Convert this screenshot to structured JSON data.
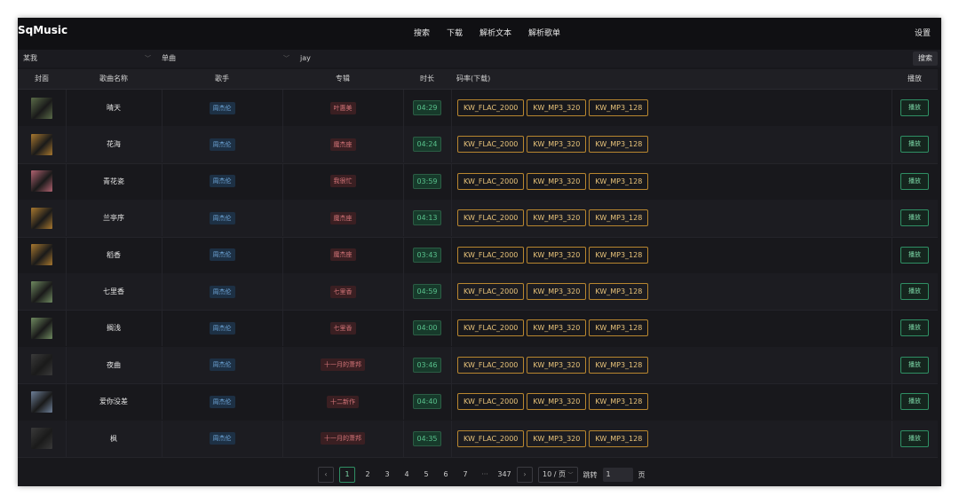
{
  "app": {
    "title": "SqMusic"
  },
  "nav": {
    "items": [
      "搜索",
      "下载",
      "解析文本",
      "解析歌单"
    ],
    "settings": "设置"
  },
  "search": {
    "source": "某我",
    "type": "单曲",
    "keyword": "jay",
    "button": "搜索"
  },
  "table": {
    "headers": [
      "封面",
      "歌曲名称",
      "歌手",
      "专辑",
      "时长",
      "码率(下载)",
      "播放"
    ],
    "rows": [
      {
        "name": "晴天",
        "singer": "周杰伦",
        "album": "叶惠美",
        "duration": "04:29",
        "cover_color": "#5a6b48"
      },
      {
        "name": "花海",
        "singer": "周杰伦",
        "album": "魔杰座",
        "duration": "04:24",
        "cover_color": "#a8782f"
      },
      {
        "name": "青花瓷",
        "singer": "周杰伦",
        "album": "我很忙",
        "duration": "03:59",
        "cover_color": "#b06270"
      },
      {
        "name": "兰亭序",
        "singer": "周杰伦",
        "album": "魔杰座",
        "duration": "04:13",
        "cover_color": "#a8782f"
      },
      {
        "name": "稻香",
        "singer": "周杰伦",
        "album": "魔杰座",
        "duration": "03:43",
        "cover_color": "#a8782f"
      },
      {
        "name": "七里香",
        "singer": "周杰伦",
        "album": "七里香",
        "duration": "04:59",
        "cover_color": "#6f8a60"
      },
      {
        "name": "搁浅",
        "singer": "周杰伦",
        "album": "七里香",
        "duration": "04:00",
        "cover_color": "#6f8a60"
      },
      {
        "name": "夜曲",
        "singer": "周杰伦",
        "album": "十一月的萧邦",
        "duration": "03:46",
        "cover_color": "#3a3a3a"
      },
      {
        "name": "爱你没差",
        "singer": "周杰伦",
        "album": "十二新作",
        "duration": "04:40",
        "cover_color": "#6d7f98"
      },
      {
        "name": "枫",
        "singer": "周杰伦",
        "album": "十一月的萧邦",
        "duration": "04:35",
        "cover_color": "#3a3a3a"
      }
    ],
    "qualities": [
      "KW_FLAC_2000",
      "KW_MP3_320",
      "KW_MP3_128"
    ],
    "play_label": "播放"
  },
  "pagination": {
    "pages": [
      "1",
      "2",
      "3",
      "4",
      "5",
      "6",
      "7"
    ],
    "ellipsis": "···",
    "last": "347",
    "current": "1",
    "page_size": "10 / 页",
    "jump_label": "跳转",
    "jump_value": "1",
    "page_suffix": "页"
  }
}
